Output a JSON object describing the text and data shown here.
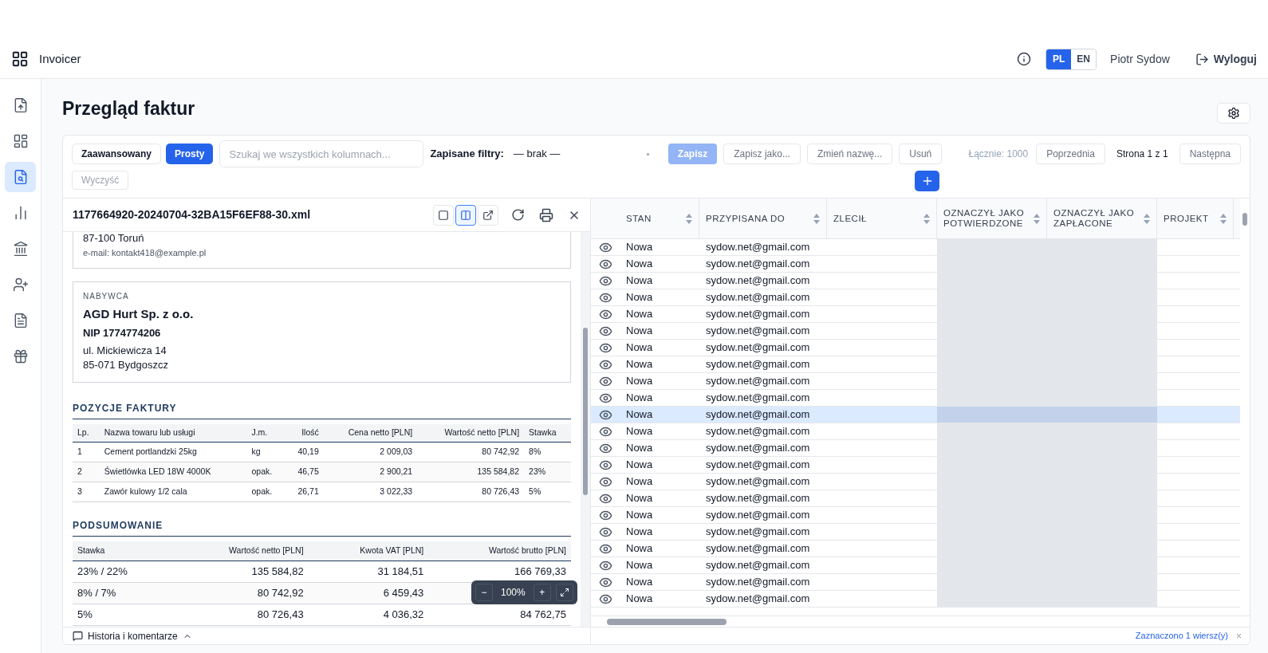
{
  "app": {
    "name": "Invoicer",
    "user": "Piotr Sydow",
    "logout": "Wyloguj"
  },
  "languages": [
    {
      "label": "PL",
      "selected": true
    },
    {
      "label": "EN",
      "selected": false
    }
  ],
  "sidebar": {
    "items": [
      {
        "selected": false
      },
      {
        "selected": false
      },
      {
        "selected": true
      },
      {
        "selected": false
      },
      {
        "selected": false
      },
      {
        "selected": false
      },
      {
        "selected": false
      },
      {
        "selected": false
      }
    ]
  },
  "page": {
    "title": "Przegląd faktur"
  },
  "toolbar": {
    "modes": [
      {
        "label": "Zaawansowany",
        "selected": false
      },
      {
        "label": "Prosty",
        "selected": true
      }
    ],
    "search": {
      "placeholder": "Szukaj we wszystkich kolumnach..."
    },
    "saved_filters_label": "Zapisane filtry:",
    "saved_filter_value": "— brak —",
    "actions": [
      {
        "label": "Zapisz",
        "kind": "primary",
        "disabled": true
      },
      {
        "label": "Zapisz jako...",
        "kind": "secondary",
        "disabled": false
      },
      {
        "label": "Zmień nazwę...",
        "kind": "secondary",
        "disabled": false
      },
      {
        "label": "Usuń",
        "kind": "secondary",
        "disabled": false
      }
    ],
    "total": "Łącznie: 1000",
    "prev": "Poprzednia",
    "page_info": "Strona 1 z 1",
    "next": "Następna",
    "clear": "Wyczyść"
  },
  "preview": {
    "filename": "1177664920-20240704-32BA15F6EF88-30.xml",
    "layout_modes": [
      {
        "selected": false
      },
      {
        "selected": true
      }
    ],
    "seller_tail": [
      "87-100 Toruń",
      "e-mail: kontakt418@example.pl"
    ],
    "buyer": {
      "heading": "NABYWCA",
      "name": "AGD Hurt Sp. z o.o.",
      "nip": "NIP 1774774206",
      "address": [
        "ul. Mickiewicza 14",
        "85-071 Bydgoszcz"
      ]
    },
    "items_heading": "POZYCJE FAKTURY",
    "items_columns": [
      "Lp.",
      "Nazwa towaru lub usługi",
      "J.m.",
      "Ilość",
      "Cena netto [PLN]",
      "Wartość netto [PLN]",
      "Stawka"
    ],
    "items": [
      [
        "1",
        "Cement portlandzki 25kg",
        "kg",
        "40,19",
        "2 009,03",
        "80 742,92",
        "8%"
      ],
      [
        "2",
        "Świetlówka LED 18W 4000K",
        "opak.",
        "46,75",
        "2 900,21",
        "135 584,82",
        "23%"
      ],
      [
        "3",
        "Zawór kulowy 1/2 cala",
        "opak.",
        "26,71",
        "3 022,33",
        "80 726,43",
        "5%"
      ]
    ],
    "summary_heading": "PODSUMOWANIE",
    "summary_columns": [
      "Stawka",
      "Wartość netto [PLN]",
      "Kwota VAT [PLN]",
      "Wartość brutto [PLN]"
    ],
    "summary": [
      [
        "23% / 22%",
        "135 584,82",
        "31 184,51",
        "166 769,33"
      ],
      [
        "8% / 7%",
        "80 742,92",
        "6 459,43"
      ],
      [
        "5%",
        "80 726,43",
        "4 036,32",
        "84 762,75"
      ]
    ],
    "zoom": {
      "minus": "−",
      "level": "100%",
      "plus": "+"
    },
    "history": "Historia i komentarze"
  },
  "table": {
    "columns": [
      {
        "label": "STAN",
        "shaded": false
      },
      {
        "label": "PRZYPISANA DO",
        "shaded": false
      },
      {
        "label": "ZLECIŁ",
        "shaded": false
      },
      {
        "label": "OZNACZYŁ JAKO POTWIERDZONE",
        "shaded": true
      },
      {
        "label": "OZNACZYŁ JAKO ZAPŁACONE",
        "shaded": true
      },
      {
        "label": "PROJEKT",
        "shaded": false
      }
    ],
    "rows": [
      {
        "status": "Nowa",
        "assigned": "sydow.net@gmail.com",
        "selected": false
      },
      {
        "status": "Nowa",
        "assigned": "sydow.net@gmail.com",
        "selected": false
      },
      {
        "status": "Nowa",
        "assigned": "sydow.net@gmail.com",
        "selected": false
      },
      {
        "status": "Nowa",
        "assigned": "sydow.net@gmail.com",
        "selected": false
      },
      {
        "status": "Nowa",
        "assigned": "sydow.net@gmail.com",
        "selected": false
      },
      {
        "status": "Nowa",
        "assigned": "sydow.net@gmail.com",
        "selected": false
      },
      {
        "status": "Nowa",
        "assigned": "sydow.net@gmail.com",
        "selected": false
      },
      {
        "status": "Nowa",
        "assigned": "sydow.net@gmail.com",
        "selected": false
      },
      {
        "status": "Nowa",
        "assigned": "sydow.net@gmail.com",
        "selected": false
      },
      {
        "status": "Nowa",
        "assigned": "sydow.net@gmail.com",
        "selected": false
      },
      {
        "status": "Nowa",
        "assigned": "sydow.net@gmail.com",
        "selected": true
      },
      {
        "status": "Nowa",
        "assigned": "sydow.net@gmail.com",
        "selected": false
      },
      {
        "status": "Nowa",
        "assigned": "sydow.net@gmail.com",
        "selected": false
      },
      {
        "status": "Nowa",
        "assigned": "sydow.net@gmail.com",
        "selected": false
      },
      {
        "status": "Nowa",
        "assigned": "sydow.net@gmail.com",
        "selected": false
      },
      {
        "status": "Nowa",
        "assigned": "sydow.net@gmail.com",
        "selected": false
      },
      {
        "status": "Nowa",
        "assigned": "sydow.net@gmail.com",
        "selected": false
      },
      {
        "status": "Nowa",
        "assigned": "sydow.net@gmail.com",
        "selected": false
      },
      {
        "status": "Nowa",
        "assigned": "sydow.net@gmail.com",
        "selected": false
      },
      {
        "status": "Nowa",
        "assigned": "sydow.net@gmail.com",
        "selected": false
      },
      {
        "status": "Nowa",
        "assigned": "sydow.net@gmail.com",
        "selected": false
      },
      {
        "status": "Nowa",
        "assigned": "sydow.net@gmail.com",
        "selected": false
      }
    ],
    "selection_info": "Zaznaczono 1 wiersz(y)",
    "selection_clear": "×"
  }
}
